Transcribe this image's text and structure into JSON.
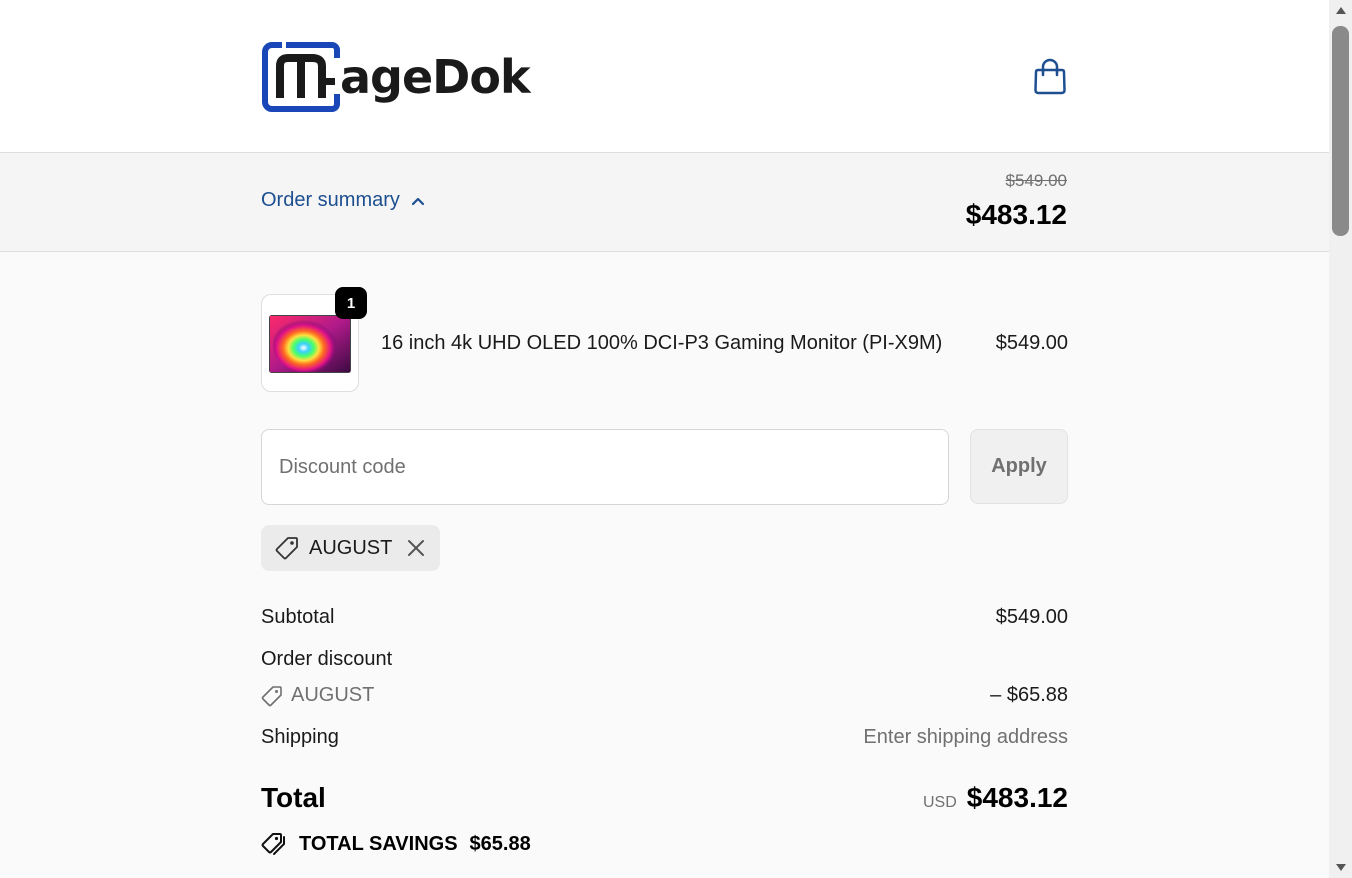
{
  "header": {
    "logo_text": "ageDok",
    "logo_full": "MageDok",
    "cart_icon": "shopping-bag-icon"
  },
  "summary": {
    "toggle_label": "Order summary",
    "toggle_icon": "chevron-up-icon",
    "original_price": "$549.00",
    "total_price": "$483.12"
  },
  "line_item": {
    "quantity": "1",
    "name": "16 inch 4k UHD OLED 100% DCI-P3 Gaming Monitor (PI-X9M)",
    "price": "$549.00"
  },
  "discount": {
    "placeholder": "Discount code",
    "apply_label": "Apply",
    "applied_code": "AUGUST"
  },
  "totals": {
    "subtotal_label": "Subtotal",
    "subtotal_value": "$549.00",
    "order_discount_label": "Order discount",
    "discount_code": "AUGUST",
    "discount_value": "– $65.88",
    "shipping_label": "Shipping",
    "shipping_value": "Enter shipping address",
    "total_label": "Total",
    "currency": "USD",
    "total_value": "$483.12",
    "savings_label": "TOTAL SAVINGS",
    "savings_value": "$65.88"
  },
  "colors": {
    "accent": "#1d4f91",
    "logo_blue": "#1a47b8",
    "text": "#1a1a1a",
    "muted": "#707070",
    "summary_bg": "#f5f5f5"
  }
}
